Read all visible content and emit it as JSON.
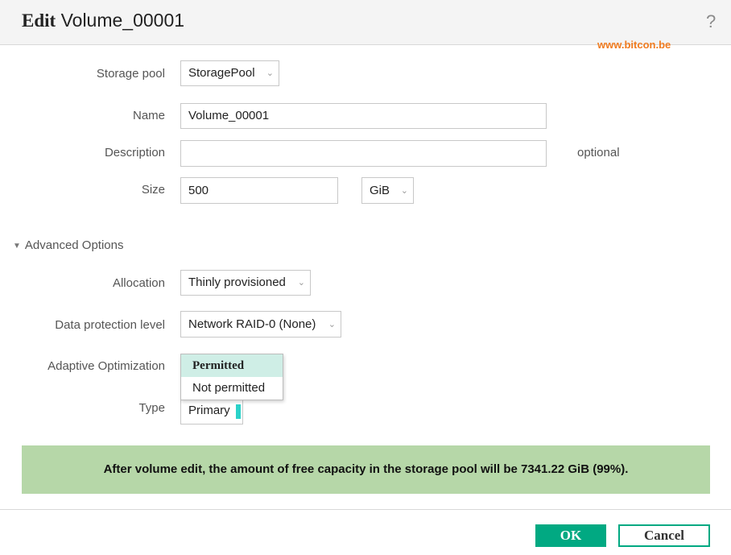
{
  "dialog": {
    "title_verb": "Edit",
    "title_name": "Volume_00001",
    "help_icon": "?",
    "watermark": "www.bitcon.be"
  },
  "form": {
    "storage_pool": {
      "label": "Storage pool",
      "value": "StoragePool"
    },
    "name": {
      "label": "Name",
      "value": "Volume_00001"
    },
    "description": {
      "label": "Description",
      "value": "",
      "hint": "optional"
    },
    "size": {
      "label": "Size",
      "value": "500",
      "unit": "GiB"
    }
  },
  "advanced": {
    "toggle_label": "Advanced Options",
    "allocation": {
      "label": "Allocation",
      "value": "Thinly provisioned"
    },
    "data_protection": {
      "label": "Data protection level",
      "value": "Network RAID-0 (None)"
    },
    "adaptive_optimization": {
      "label": "Adaptive Optimization",
      "options": [
        "Permitted",
        "Not permitted"
      ],
      "highlighted": "Permitted"
    },
    "type": {
      "label": "Type",
      "value": "Primary"
    }
  },
  "banner": {
    "text": "After volume edit, the amount of free capacity in the storage pool will be 7341.22 GiB (99%)."
  },
  "buttons": {
    "ok": "OK",
    "cancel": "Cancel"
  },
  "colors": {
    "accent": "#01a982",
    "banner_bg": "#b6d7a8",
    "watermark": "#f07c20",
    "dropdown_highlight": "#cfeee6",
    "type_indicator": "#2ad2c9"
  },
  "icons": {
    "help": "help-icon",
    "caret": "chevron-down-icon",
    "expand": "triangle-down-icon"
  }
}
